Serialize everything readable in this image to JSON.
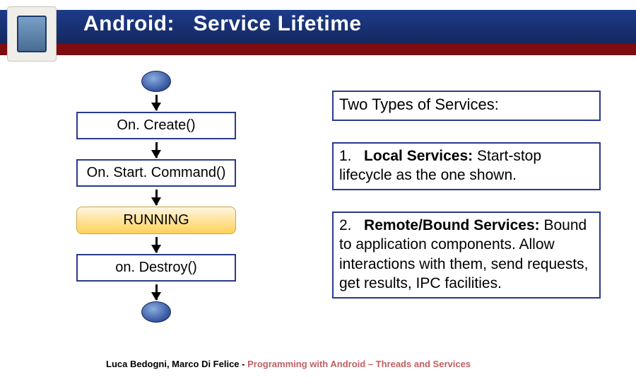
{
  "header": {
    "title_prefix": "Android:",
    "title_suffix": "Service Lifetime"
  },
  "flow": {
    "onCreate": "On. Create()",
    "onStart": "On. Start. Command()",
    "running": "RUNNING",
    "onDestroy": "on. Destroy()"
  },
  "right": {
    "heading": "Two Types of Services:",
    "item1_num": "1.",
    "item1_title": "Local Services:",
    "item1_tail": " Start-stop lifecycle as the one shown.",
    "item2_num": "2.",
    "item2_title": "Remote/Bound Services:",
    "item2_tail": " Bound to application components. Allow interactions with them, send requests, get results, IPC facilities."
  },
  "footer": {
    "authors": "Luca Bedogni, Marco Di Felice",
    "sep": " - ",
    "course": "Programming with Android – Threads and Services"
  }
}
